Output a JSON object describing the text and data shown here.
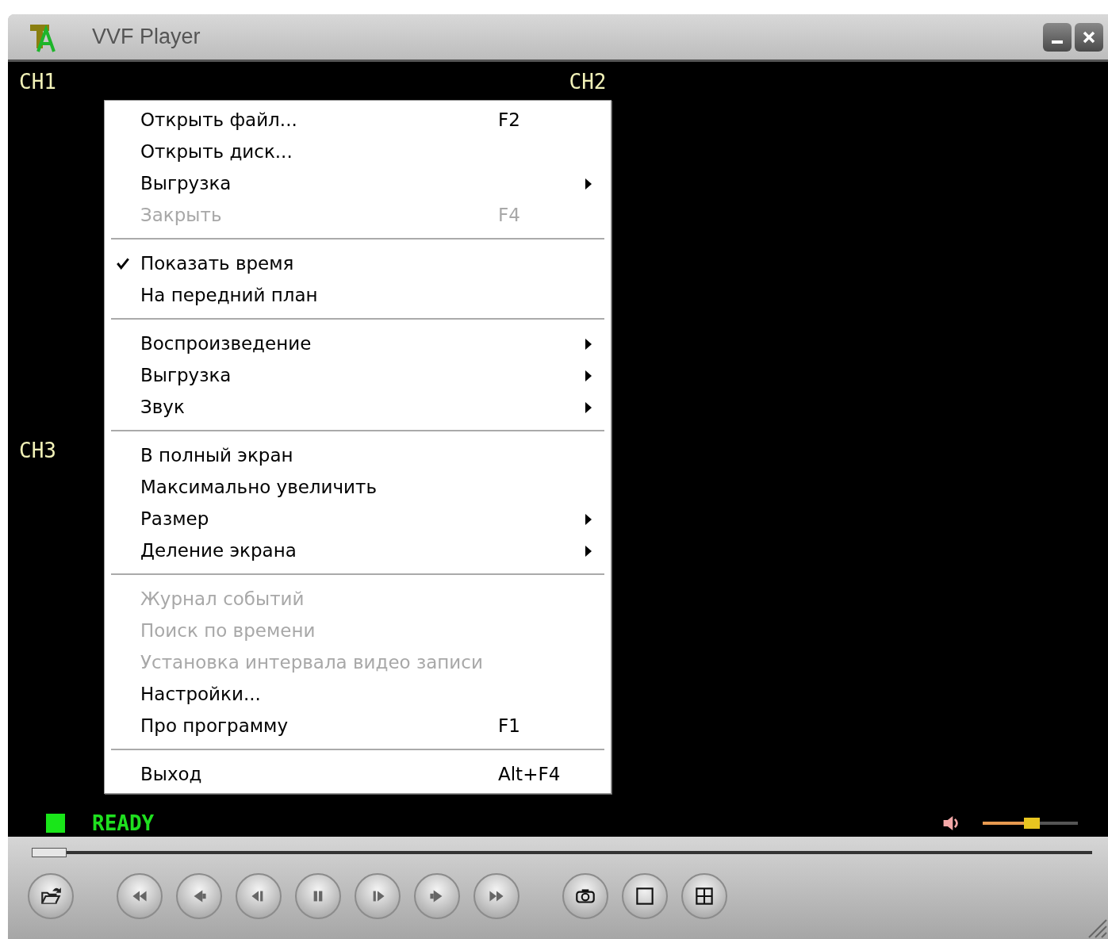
{
  "window": {
    "title": "VVF Player"
  },
  "channels": [
    {
      "label": "CH1"
    },
    {
      "label": "CH2"
    },
    {
      "label": "CH3"
    }
  ],
  "status": {
    "text": "READY",
    "on": true
  },
  "volume": {
    "level": 0.52
  },
  "seek": {
    "level": 0
  },
  "context_menu": {
    "items": [
      {
        "kind": "item",
        "label": "Открыть файл...",
        "shortcut": "F2",
        "submenu": false,
        "disabled": false,
        "checked": false
      },
      {
        "kind": "item",
        "label": "Открыть диск...",
        "submenu": false,
        "disabled": false,
        "checked": false
      },
      {
        "kind": "item",
        "label": "Выгрузка",
        "submenu": true,
        "disabled": false,
        "checked": false
      },
      {
        "kind": "item",
        "label": "Закрыть",
        "shortcut": "F4",
        "submenu": false,
        "disabled": true,
        "checked": false
      },
      {
        "kind": "separator"
      },
      {
        "kind": "item",
        "label": "Показать время",
        "submenu": false,
        "disabled": false,
        "checked": true
      },
      {
        "kind": "item",
        "label": "На передний план",
        "submenu": false,
        "disabled": false,
        "checked": false
      },
      {
        "kind": "separator"
      },
      {
        "kind": "item",
        "label": "Воспроизведение",
        "submenu": true,
        "disabled": false,
        "checked": false
      },
      {
        "kind": "item",
        "label": "Выгрузка",
        "submenu": true,
        "disabled": false,
        "checked": false
      },
      {
        "kind": "item",
        "label": "Звук",
        "submenu": true,
        "disabled": false,
        "checked": false
      },
      {
        "kind": "separator"
      },
      {
        "kind": "item",
        "label": "В полный экран",
        "submenu": false,
        "disabled": false,
        "checked": false
      },
      {
        "kind": "item",
        "label": "Максимально увеличить",
        "submenu": false,
        "disabled": false,
        "checked": false
      },
      {
        "kind": "item",
        "label": "Размер",
        "submenu": true,
        "disabled": false,
        "checked": false
      },
      {
        "kind": "item",
        "label": "Деление экрана",
        "submenu": true,
        "disabled": false,
        "checked": false
      },
      {
        "kind": "separator"
      },
      {
        "kind": "item",
        "label": "Журнал событий",
        "submenu": false,
        "disabled": true,
        "checked": false
      },
      {
        "kind": "item",
        "label": "Поиск по времени",
        "submenu": false,
        "disabled": true,
        "checked": false
      },
      {
        "kind": "item",
        "label": "Установка интервала видео записи",
        "submenu": false,
        "disabled": true,
        "checked": false
      },
      {
        "kind": "item",
        "label": "Настройки...",
        "submenu": false,
        "disabled": false,
        "checked": false
      },
      {
        "kind": "item",
        "label": "Про программу",
        "shortcut": "F1",
        "submenu": false,
        "disabled": false,
        "checked": false
      },
      {
        "kind": "separator"
      },
      {
        "kind": "item",
        "label": "Выход",
        "shortcut": "Alt+F4",
        "submenu": false,
        "disabled": false,
        "checked": false
      }
    ]
  },
  "controls": [
    {
      "kind": "open"
    },
    {
      "kind": "gap"
    },
    {
      "kind": "fast-rewind"
    },
    {
      "kind": "rewind"
    },
    {
      "kind": "step-back"
    },
    {
      "kind": "pause"
    },
    {
      "kind": "step-forward"
    },
    {
      "kind": "play"
    },
    {
      "kind": "fast-forward"
    },
    {
      "kind": "gap"
    },
    {
      "kind": "snapshot"
    },
    {
      "kind": "single-view"
    },
    {
      "kind": "quad-view"
    }
  ]
}
